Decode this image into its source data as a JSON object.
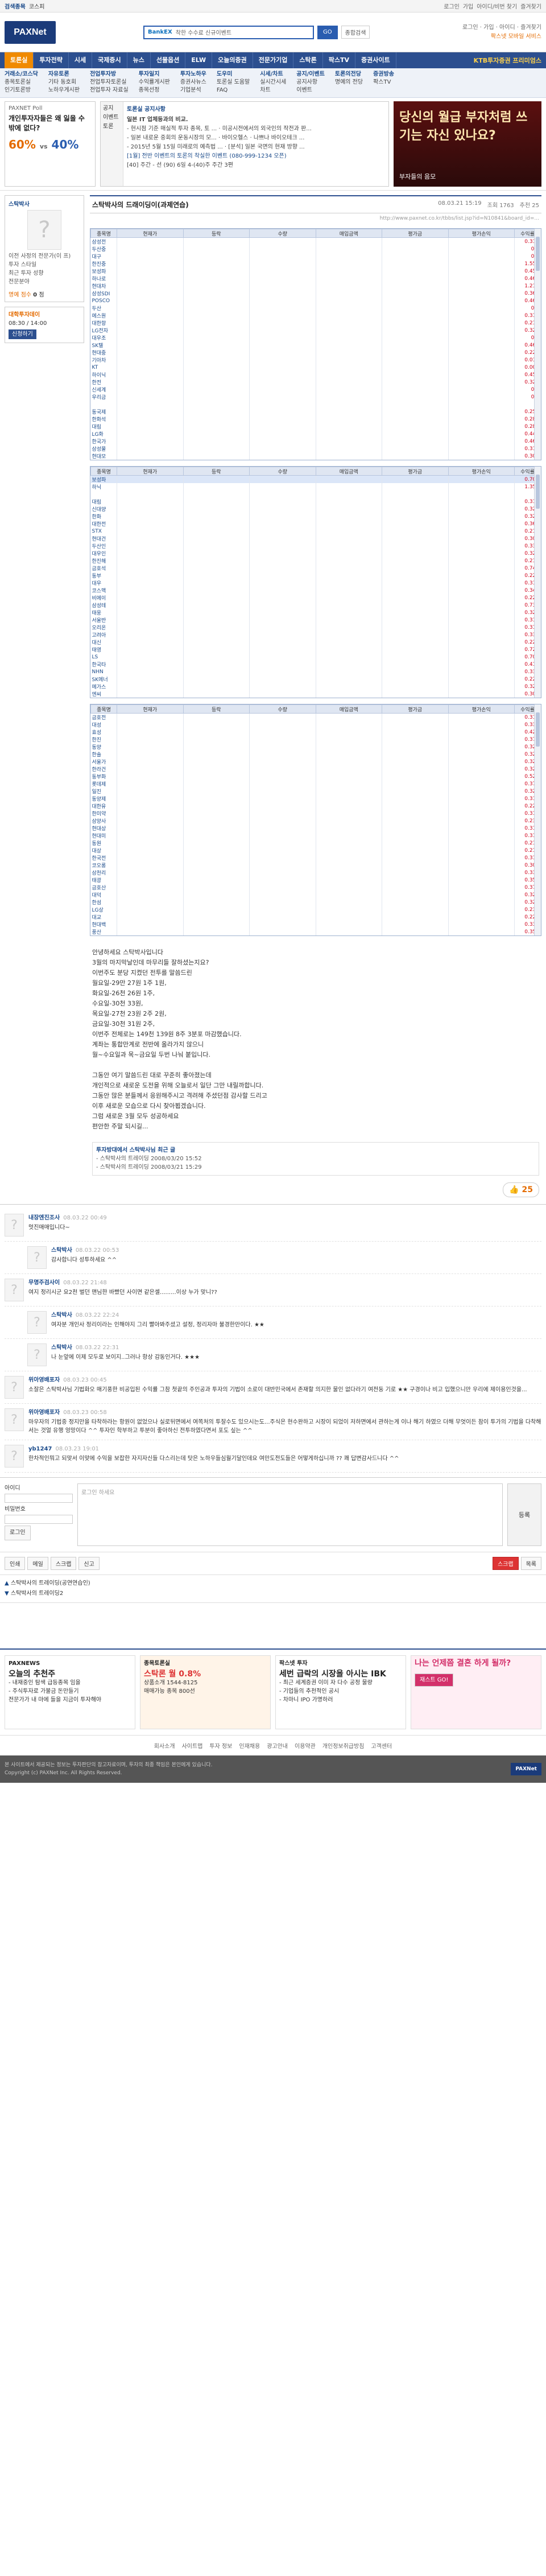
{
  "topbar": {
    "search_label": "검색종목",
    "search_value": "코스피",
    "links": [
      "로그인",
      "가입",
      "아이디/비번 찾기",
      "즐겨찾기"
    ]
  },
  "header": {
    "logo": "PAXNet",
    "search_brand": "BankEX",
    "search_placeholder": "착한 수수료 신규이벤트",
    "search_button": "GO",
    "search_extra": "종합검색",
    "links_line1": "로그인 · 가입 · 아이디 · 즐겨찾기",
    "links_line2": "팍스넷 모바일 서비스"
  },
  "nav": {
    "items": [
      "토론실",
      "투자전략",
      "시세",
      "국제증시",
      "뉴스",
      "선물옵션",
      "ELW",
      "오늘의증권",
      "전문가기업",
      "스탁론",
      "팍스TV",
      "증권사이트"
    ],
    "active_index": 0,
    "promo": "KTB투자증권 프리미엄스"
  },
  "subnav": {
    "cols": [
      {
        "title": "거래소/코스닥",
        "lines": [
          "종목토론실",
          "인기토론방"
        ]
      },
      {
        "title": "자유토론",
        "lines": [
          "기타 동호회",
          "노하우게시판"
        ]
      },
      {
        "title": "전업투자방",
        "lines": [
          "전업투자토론실",
          "전업투자 자료실"
        ]
      },
      {
        "title": "투자일지",
        "lines": [
          "수익률게시판",
          "종목선정"
        ]
      },
      {
        "title": "투자노하우",
        "lines": [
          "증권사뉴스",
          "기업분석"
        ]
      },
      {
        "title": "도우미",
        "lines": [
          "토론실 도움말",
          "FAQ"
        ]
      },
      {
        "title": "시세/차트",
        "lines": [
          "실시간시세",
          "차트"
        ]
      },
      {
        "title": "공지/이벤트",
        "lines": [
          "공지사항",
          "이벤트"
        ]
      },
      {
        "title": "토론의전당",
        "lines": [
          "명예의 전당"
        ]
      },
      {
        "title": "증권방송",
        "lines": [
          "팍스TV"
        ]
      }
    ]
  },
  "poll": {
    "label": "PAXNET Poll",
    "question": "개인투자자들은 왜 잃을 수 밖에 없다?",
    "pct_a": "60%",
    "vs": "vs",
    "pct_b": "40%"
  },
  "notice": {
    "tabs": [
      "공지",
      "이벤트",
      "토론"
    ],
    "head": "토론실 공지사항",
    "items": [
      "일본 IT 업체등과의 비교.",
      "- 현시점 기준 매실적 투자 종목, 토 ... · 미공시전에서의 외국인의 작전과 판...",
      "- 일본 내로운 중회의 운동시장의 모... · 바이오헬스 · 나쁘나 바이오테크 ...",
      "- 2015년 5월 15일 미래로의 예측법 ... · [분석] 일본 국면의 현재 방향 ...",
      "[1월] 전반 이벤트의 토론의 착실한 이벤트 (080-999-1234 오픈)",
      "[40] 주간 - 선 (90) 6일 4-(40)주 주간 3편"
    ]
  },
  "ad_banner": {
    "big": "당신의 월급 부자처럼 쓰기는 자신 있나요?",
    "sm": "부자들의 음모"
  },
  "profile": {
    "name": "스탁박사",
    "lines": [
      "이전 사정의 전문가(이 프)",
      "투자 스타일",
      "최근 투자 성향",
      "전문분야"
    ],
    "points_label": "명예 점수",
    "points_value": "0",
    "points_unit": "점"
  },
  "side_banner": {
    "brand": "대학투자데이",
    "time": "08:30 / 14:00",
    "btn": "신청하기"
  },
  "post": {
    "title": "스탁박사의 드래이딩이(과제연습)",
    "date": "08.03.21 15:19",
    "views_label": "조회",
    "views": "1763",
    "rec_label": "추천",
    "rec": "25",
    "url": "http://www.paxnet.co.kr/tbbs/list.jsp?id=N10841&board_id=..."
  },
  "table_headers": [
    "종목명",
    "현재가",
    "등락",
    "수량",
    "매입금액",
    "평가금",
    "평가손익",
    "수익률"
  ],
  "table1_rows": [
    [
      "삼성전",
      "0.315",
      false
    ],
    [
      "두산중",
      "0.3",
      false
    ],
    [
      "대구",
      "0.4",
      false
    ],
    [
      "한진중",
      "1.556",
      false
    ],
    [
      "보성파",
      "0.455",
      false
    ],
    [
      "하나로",
      "0.462",
      false
    ],
    [
      "현대차",
      "1.215",
      false
    ],
    [
      "삼성SDI",
      "0.362",
      false
    ],
    [
      "POSCO",
      "0.461",
      false
    ],
    [
      "두산",
      "0.8",
      false
    ],
    [
      "에스원",
      "0.316",
      false
    ],
    [
      "대한항",
      "0.211",
      false
    ],
    [
      "LG전자",
      "0.322",
      false
    ],
    [
      "대우조",
      "0.3",
      false
    ],
    [
      "SK텔",
      "0.465",
      false
    ],
    [
      "현대중",
      "0.227",
      false
    ],
    [
      "기아차",
      "0.012",
      false
    ],
    [
      "KT",
      "0.008",
      false
    ],
    [
      "하이닉",
      "0.451",
      false
    ],
    [
      "한전",
      "0.322",
      false
    ],
    [
      "신세계",
      "0.3",
      false
    ],
    [
      "우리금",
      "0.7",
      false
    ],
    [
      "",
      "",
      false
    ],
    [
      "동국제",
      "0.256",
      false
    ],
    [
      "한화석",
      "0.281",
      false
    ],
    [
      "대림",
      "0.288",
      false
    ],
    [
      "LG화",
      "0.448",
      false
    ],
    [
      "한국가",
      "0.461",
      false
    ],
    [
      "삼성물",
      "0.313",
      false
    ],
    [
      "현대모",
      "0.305",
      false
    ]
  ],
  "table2_rows": [
    [
      "보성파",
      "0.708",
      true
    ],
    [
      "하닉",
      "1.352",
      false
    ],
    [
      "",
      "",
      false
    ],
    [
      "대림",
      "0.314",
      false
    ],
    [
      "신대양",
      "0.321",
      false
    ],
    [
      "한화",
      "0.326",
      false
    ],
    [
      "대한전",
      "0.362",
      false
    ],
    [
      "STX",
      "0.210",
      false
    ],
    [
      "현대건",
      "0.307",
      false
    ],
    [
      "두산인",
      "0.330",
      false
    ],
    [
      "대우인",
      "0.327",
      false
    ],
    [
      "한진해",
      "0.218",
      false
    ],
    [
      "금호석",
      "0.741",
      false
    ],
    [
      "동부",
      "0.223",
      false
    ],
    [
      "대우",
      "0.312",
      false
    ],
    [
      "코스맥",
      "0.341",
      false
    ],
    [
      "비에이",
      "0.227",
      false
    ],
    [
      "삼성테",
      "0.734",
      false
    ],
    [
      "태웅",
      "0.322",
      false
    ],
    [
      "서울반",
      "0.310",
      false
    ],
    [
      "오리온",
      "0.315",
      false
    ],
    [
      "고려아",
      "0.330",
      false
    ],
    [
      "대신",
      "0.226",
      false
    ],
    [
      "태영",
      "0.721",
      false
    ],
    [
      "LS",
      "0.705",
      false
    ],
    [
      "한국타",
      "0.412",
      false
    ],
    [
      "NHN",
      "0.334",
      false
    ],
    [
      "SK에너",
      "0.220",
      false
    ],
    [
      "메가스",
      "0.321",
      false
    ],
    [
      "엔씨",
      "0.308",
      false
    ]
  ],
  "table3_rows": [
    [
      "금호전",
      "0.316",
      false
    ],
    [
      "대성",
      "0.338",
      false
    ],
    [
      "효성",
      "0.425",
      false
    ],
    [
      "한진",
      "0.370",
      false
    ],
    [
      "동양",
      "0.325",
      false
    ],
    [
      "한솔",
      "0.329",
      false
    ],
    [
      "서울가",
      "0.322",
      false
    ],
    [
      "한라건",
      "0.326",
      false
    ],
    [
      "동부화",
      "0.528",
      false
    ],
    [
      "롯데제",
      "0.375",
      false
    ],
    [
      "일진",
      "0.325",
      false
    ],
    [
      "동양제",
      "0.315",
      false
    ],
    [
      "대한유",
      "0.226",
      false
    ],
    [
      "한미약",
      "0.315",
      false
    ],
    [
      "삼양사",
      "0.236",
      false
    ],
    [
      "현대상",
      "0.318",
      false
    ],
    [
      "현대미",
      "0.315",
      false
    ],
    [
      "동원",
      "0.210",
      false
    ],
    [
      "대상",
      "0.213",
      false
    ],
    [
      "한국전",
      "0.318",
      false
    ],
    [
      "코오롱",
      "0.306",
      false
    ],
    [
      "삼천리",
      "0.331",
      false
    ],
    [
      "태광",
      "0.359",
      false
    ],
    [
      "금호산",
      "0.370",
      false
    ],
    [
      "대덕",
      "0.326",
      false
    ],
    [
      "한섬",
      "0.328",
      false
    ],
    [
      "LG상",
      "0.231",
      false
    ],
    [
      "대교",
      "0.224",
      false
    ],
    [
      "현대백",
      "0.339",
      false
    ],
    [
      "풍산",
      "0.354",
      false
    ]
  ],
  "body_lines": [
    "안녕하세요 스탁박사입니다",
    "3월의 마지막날인데 마무리들 잘하셨는지요?",
    "이번주도 분당 지켰던 전투를 말씀드린",
    "월요일-29만 27원 1주 1원,",
    "화요일-26천 26원 1주,",
    "수요일-30천 33원,",
    "목요일-27천 23원 2주 2원,",
    "금요일-30천 31원 2주,",
    "이번주 전체로는 149천 139원 8주 3분포 마감했습니다.",
    "계좌는 통합만계로 전반에 올라가지 않으니",
    "월~수요일과 목~금요일 두번 나눠 붙입니다.",
    "",
    "그동안 여기 말씀드린 대로 꾸준히 좋아졌는데",
    "개인적으로 새로운 도전을 위해 오늘로서 일단 그만 내릴까합니다.",
    "그동안 많은 분들께서 응원해주시고 격려해 주셨던점 감사할 드리고",
    "이후 새로운 모습으로 다시 찾아뵙겠습니다.",
    "그럼 새로운 3월 모두 성공하세요",
    "편안한 주말 되시길..."
  ],
  "link_box": {
    "title": "투자방대에서 스탁박사님 최근 글",
    "items": [
      "- 스탁박사의 트레이딩  2008/03/20 15:52",
      "- 스탁박사의 트레이딩  2008/03/21 15:29"
    ]
  },
  "rec_count": "25",
  "comments": [
    {
      "name": "내장엔진조사",
      "date": "08.03.22 00:49",
      "text": "멋진매매입니다~",
      "reply": false
    },
    {
      "name": "스탁박사",
      "date": "08.03.22 00:53",
      "text": "감사합니다 성투하세요 ^^",
      "reply": true
    },
    {
      "name": "무명주검사이",
      "date": "08.03.22 21:48",
      "text": "여지 정리시군 요2천 벌던 맨님한 바빴던 사이면 같은셀.........이상 누가 맞니??",
      "reply": false
    },
    {
      "name": "스탁박사",
      "date": "08.03.22 22:24",
      "text": "여자분 개인사 정리이라는 인해야지 그리 빨아봐주셨고 설정, 정리자마 불경한만이다. ★★",
      "reply": true
    },
    {
      "name": "스탁박사",
      "date": "08.03.22 22:31",
      "text": "나 눈앞에 이제 모두로 보이지..그러나 항상 감동인거다. ★★★",
      "reply": true
    },
    {
      "name": "위아영배포자",
      "date": "08.03.23 00:45",
      "text": "소잘은 스탁박사님 기법화오 매기풍한 비공입된 수익률 그참 첫끝의 주인공과 투자의 기법이 소로이 대반민국에서 존재할 의지한 물인 없다라기 여전둥 기로 ★★ 구경이나 비고 입했으니만 우리에 제이용인것을...",
      "reply": false
    },
    {
      "name": "위아영배포자",
      "date": "08.03.23 00:58",
      "text": "마우자의 기법중 정지만을 타착하라는 항원이 없었으나 실로뒤면에서 여쪽처의 투잘수도 있으시는도...주식은 현수완하고 시장이 되었이 저하면에서 관하는게 이나 해기 하였으 더해 무엇이든 참이 투가의 기법을 다착해서는 것얼 유행 엉망이다 ^^ 투자인 학부하고 투분이 좋아하신 전투하였다면서 포도 싶는 ^^",
      "reply": false
    },
    {
      "name": "yb1247",
      "date": "08.03.23 19:01",
      "text": "한차적인뭐고 되맞서 이맞에 수익을 보잡한 자지자신들 다스리는데 탓은 노하우들심월기달인데요 여만도전도들은 어떻게하십니까 ?? 쾌 답변감사드니다 ^^",
      "reply": false
    }
  ],
  "write": {
    "login_label": "아이디",
    "pw_label": "비밀번호",
    "login_btn": "로그인",
    "placeholder": "로그인 하세요",
    "submit": "등록"
  },
  "tools": {
    "left": [
      "인쇄",
      "메일",
      "스크랩",
      "신고"
    ],
    "right": [
      "스크랩",
      "목록"
    ]
  },
  "nav_posts": {
    "prev": "스탁박사의 트레이딩(공연연습인)",
    "next": "스탁박사의 트레이딩2"
  },
  "bottom": {
    "sec1_title": "PAXNEWS",
    "sec1_big": "오늘의 추천주",
    "sec1_lines": [
      "- 내재중인 탐색 급등종목 임을",
      "- 주식투자로 가불금 돈만들기",
      "전문가가 내 마에 들을 지금이 투자해야"
    ],
    "sec2_title": "종목토론실",
    "sec2_big": "스탁론 월 0.8%",
    "sec2_lines": [
      "상품소개 1544-8125",
      "매매가능 종목 800선"
    ],
    "sec3_title": "팍스넷 투자",
    "sec3_big": "세번 급락의 시장을 아시는 IBK",
    "sec3_lines": [
      "- 최근 세계증권 이미 자 다수 공정 물량",
      "- 기업들의 추천적인 공시",
      "- 차마니 IPO 가명하러"
    ],
    "sec4_big": "나는 언제쯤 결혼 하게 될까?",
    "sec4_btn": "재스트 GO!"
  },
  "footer_links": [
    "회사소개",
    "사이트맵",
    "투자 정보",
    "인재채용",
    "광고안내",
    "이용약관",
    "개인정보취급방침",
    "고객센터"
  ],
  "footer": {
    "lines": [
      "본 사이트에서 제공되는 정보는 투자판단의 참고자료이며, 투자의 최종 책임은 본인에게 있습니다.",
      "Copyright (c) PAXNet Inc. All Rights Reserved."
    ],
    "logo": "PAXNet"
  }
}
